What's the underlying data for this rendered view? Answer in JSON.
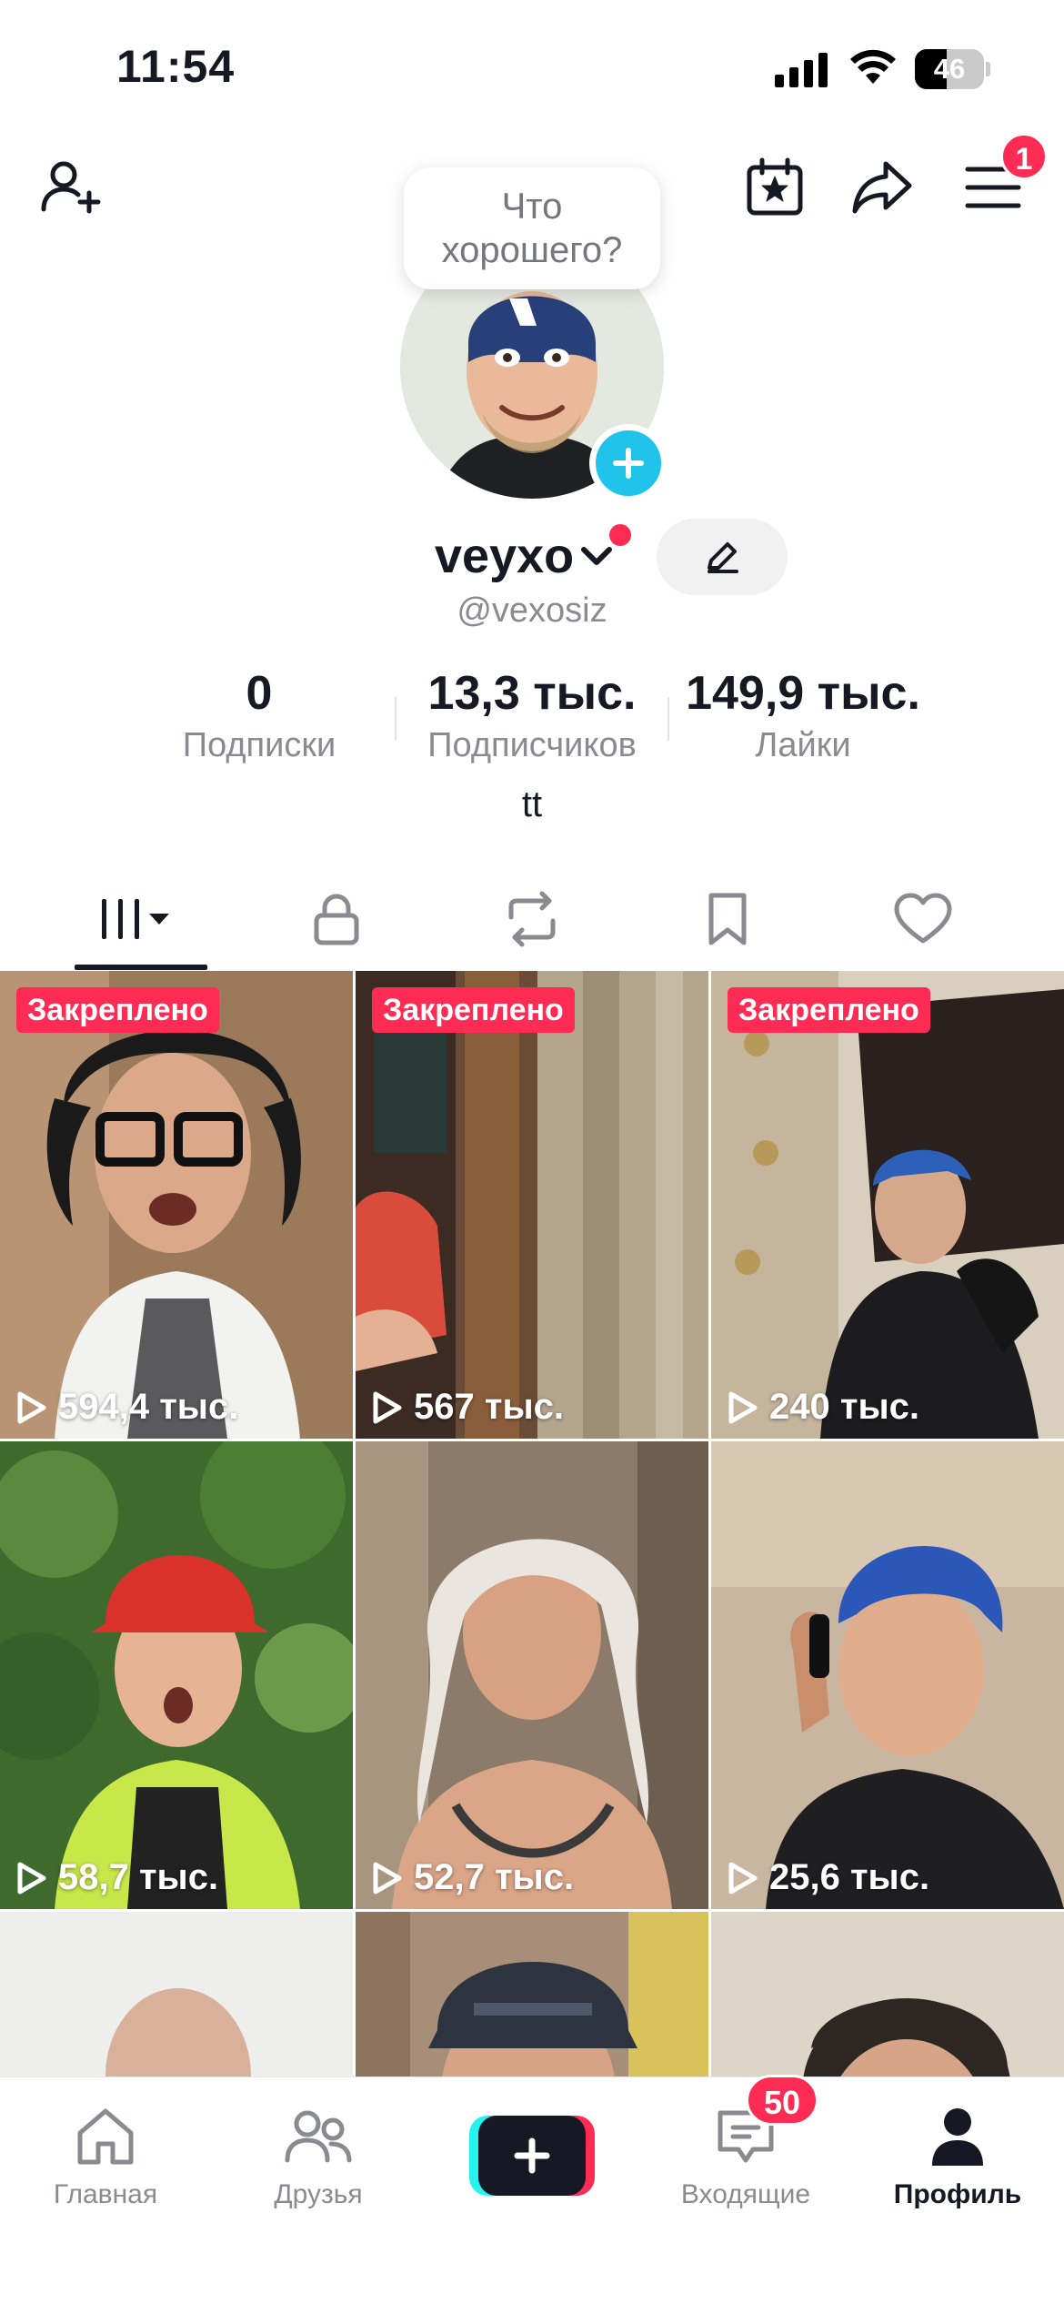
{
  "status_bar": {
    "time": "11:54",
    "battery": "46",
    "battery_level": 0.46,
    "icons": [
      "signal-icon",
      "wifi-icon",
      "battery-icon"
    ]
  },
  "header": {
    "notification_count": "1",
    "icons": [
      "add-friend-icon",
      "calendar-star-icon",
      "share-icon",
      "menu-icon"
    ]
  },
  "profile": {
    "status_prompt": "Что хорошего?",
    "username": "veyxo",
    "handle": "@vexosiz",
    "bio": "tt",
    "stats": {
      "following_value": "0",
      "following_label": "Подписки",
      "followers_value": "13,3 тыс.",
      "followers_label": "Подписчиков",
      "likes_value": "149,9 тыс.",
      "likes_label": "Лайки"
    }
  },
  "tabs": {
    "active": "videos",
    "icons": [
      "videos-grid-icon",
      "lock-icon",
      "repost-icon",
      "bookmark-icon",
      "heart-icon"
    ]
  },
  "videos": [
    {
      "pinned_label": "Закреплено",
      "views": "594,4 тыс."
    },
    {
      "pinned_label": "Закреплено",
      "views": "567 тыс."
    },
    {
      "pinned_label": "Закреплено",
      "views": "240 тыс."
    },
    {
      "pinned_label": "",
      "views": "58,7 тыс."
    },
    {
      "pinned_label": "",
      "views": "52,7 тыс."
    },
    {
      "pinned_label": "",
      "views": "25,6 тыс."
    },
    {
      "pinned_label": "",
      "views": ""
    },
    {
      "pinned_label": "",
      "views": ""
    },
    {
      "pinned_label": "",
      "views": ""
    }
  ],
  "bottom_nav": {
    "home": "Главная",
    "friends": "Друзья",
    "inbox": "Входящие",
    "inbox_badge": "50",
    "profile": "Профиль"
  },
  "colors": {
    "accent": "#fe2c55",
    "avatar_add": "#20c4ea",
    "text_primary": "#161823",
    "text_secondary": "#8a8b91"
  }
}
